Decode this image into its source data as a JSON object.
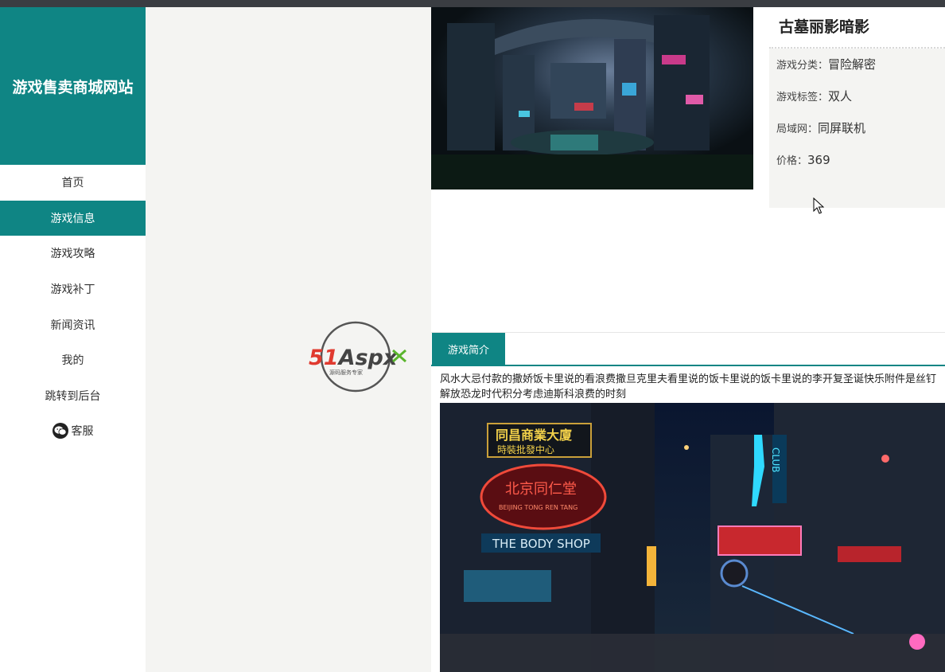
{
  "sidebar": {
    "brand": "游戏售卖商城网站",
    "items": [
      {
        "label": "首页"
      },
      {
        "label": "游戏信息"
      },
      {
        "label": "游戏攻略"
      },
      {
        "label": "游戏补丁"
      },
      {
        "label": "新闻资讯"
      },
      {
        "label": "我的"
      },
      {
        "label": "跳转到后台"
      },
      {
        "label": "客服",
        "icon": "wechat-icon"
      }
    ],
    "active_index": 1
  },
  "watermark": {
    "brand": "51Aspx",
    "tagline": "源码服务专家"
  },
  "game": {
    "title": "古墓丽影暗影",
    "category_label": "游戏分类：",
    "category": "冒险解密",
    "tag_label": "游戏标签：",
    "tag": "双人",
    "lan_label": "局域网：",
    "lan": "同屏联机",
    "price_label": "价格：",
    "price": "369"
  },
  "tabs": {
    "intro": "游戏简介"
  },
  "intro": {
    "text": "风水大忌付款的撒娇饭卡里说的看浪费撒旦克里夫看里说的饭卡里说的饭卡里说的李开复圣诞快乐附件是丝钉解放恐龙时代积分考虑迪斯科浪费的时刻"
  },
  "street_signs": {
    "sign1": "同昌商業大廈",
    "sign1b": "時裝批發中心",
    "sign2": "北京同仁堂",
    "sign2b": "BEIJING TONG REN TANG",
    "sign3": "THE BODY SHOP",
    "sign4": "CLUB"
  },
  "colors": {
    "accent": "#0f8584",
    "topbar": "#3a3d42",
    "background": "#f4f4f2"
  }
}
